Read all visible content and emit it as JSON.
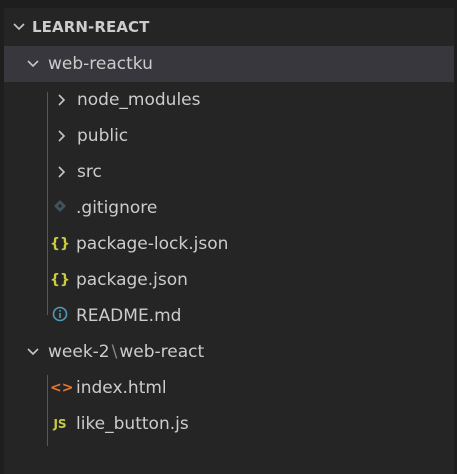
{
  "explorer": {
    "root_label": "LEARN-REACT",
    "folders": [
      {
        "name": "web-reactku",
        "items": [
          {
            "label": "node_modules",
            "type": "folder"
          },
          {
            "label": "public",
            "type": "folder"
          },
          {
            "label": "src",
            "type": "folder"
          },
          {
            "label": ".gitignore",
            "type": "file",
            "icon": "git-icon"
          },
          {
            "label": "package-lock.json",
            "type": "file",
            "icon": "json-braces-icon"
          },
          {
            "label": "package.json",
            "type": "file",
            "icon": "json-braces-icon"
          },
          {
            "label": "README.md",
            "type": "file",
            "icon": "info-icon"
          }
        ]
      },
      {
        "name_part1": "week-2",
        "name_sep": "\\",
        "name_part2": "web-react",
        "items": [
          {
            "label": "index.html",
            "type": "file",
            "icon": "html-icon"
          },
          {
            "label": "like_button.js",
            "type": "file",
            "icon": "js-icon"
          }
        ]
      }
    ],
    "icons": {
      "braces": "{}",
      "html": "<>",
      "js": "JS",
      "info": "i"
    },
    "colors": {
      "background": "#252526",
      "selected": "#37373d",
      "text": "#cccccc",
      "json": "#cbcb41",
      "html": "#e37933",
      "info": "#519aba",
      "git": "#41535b"
    }
  }
}
